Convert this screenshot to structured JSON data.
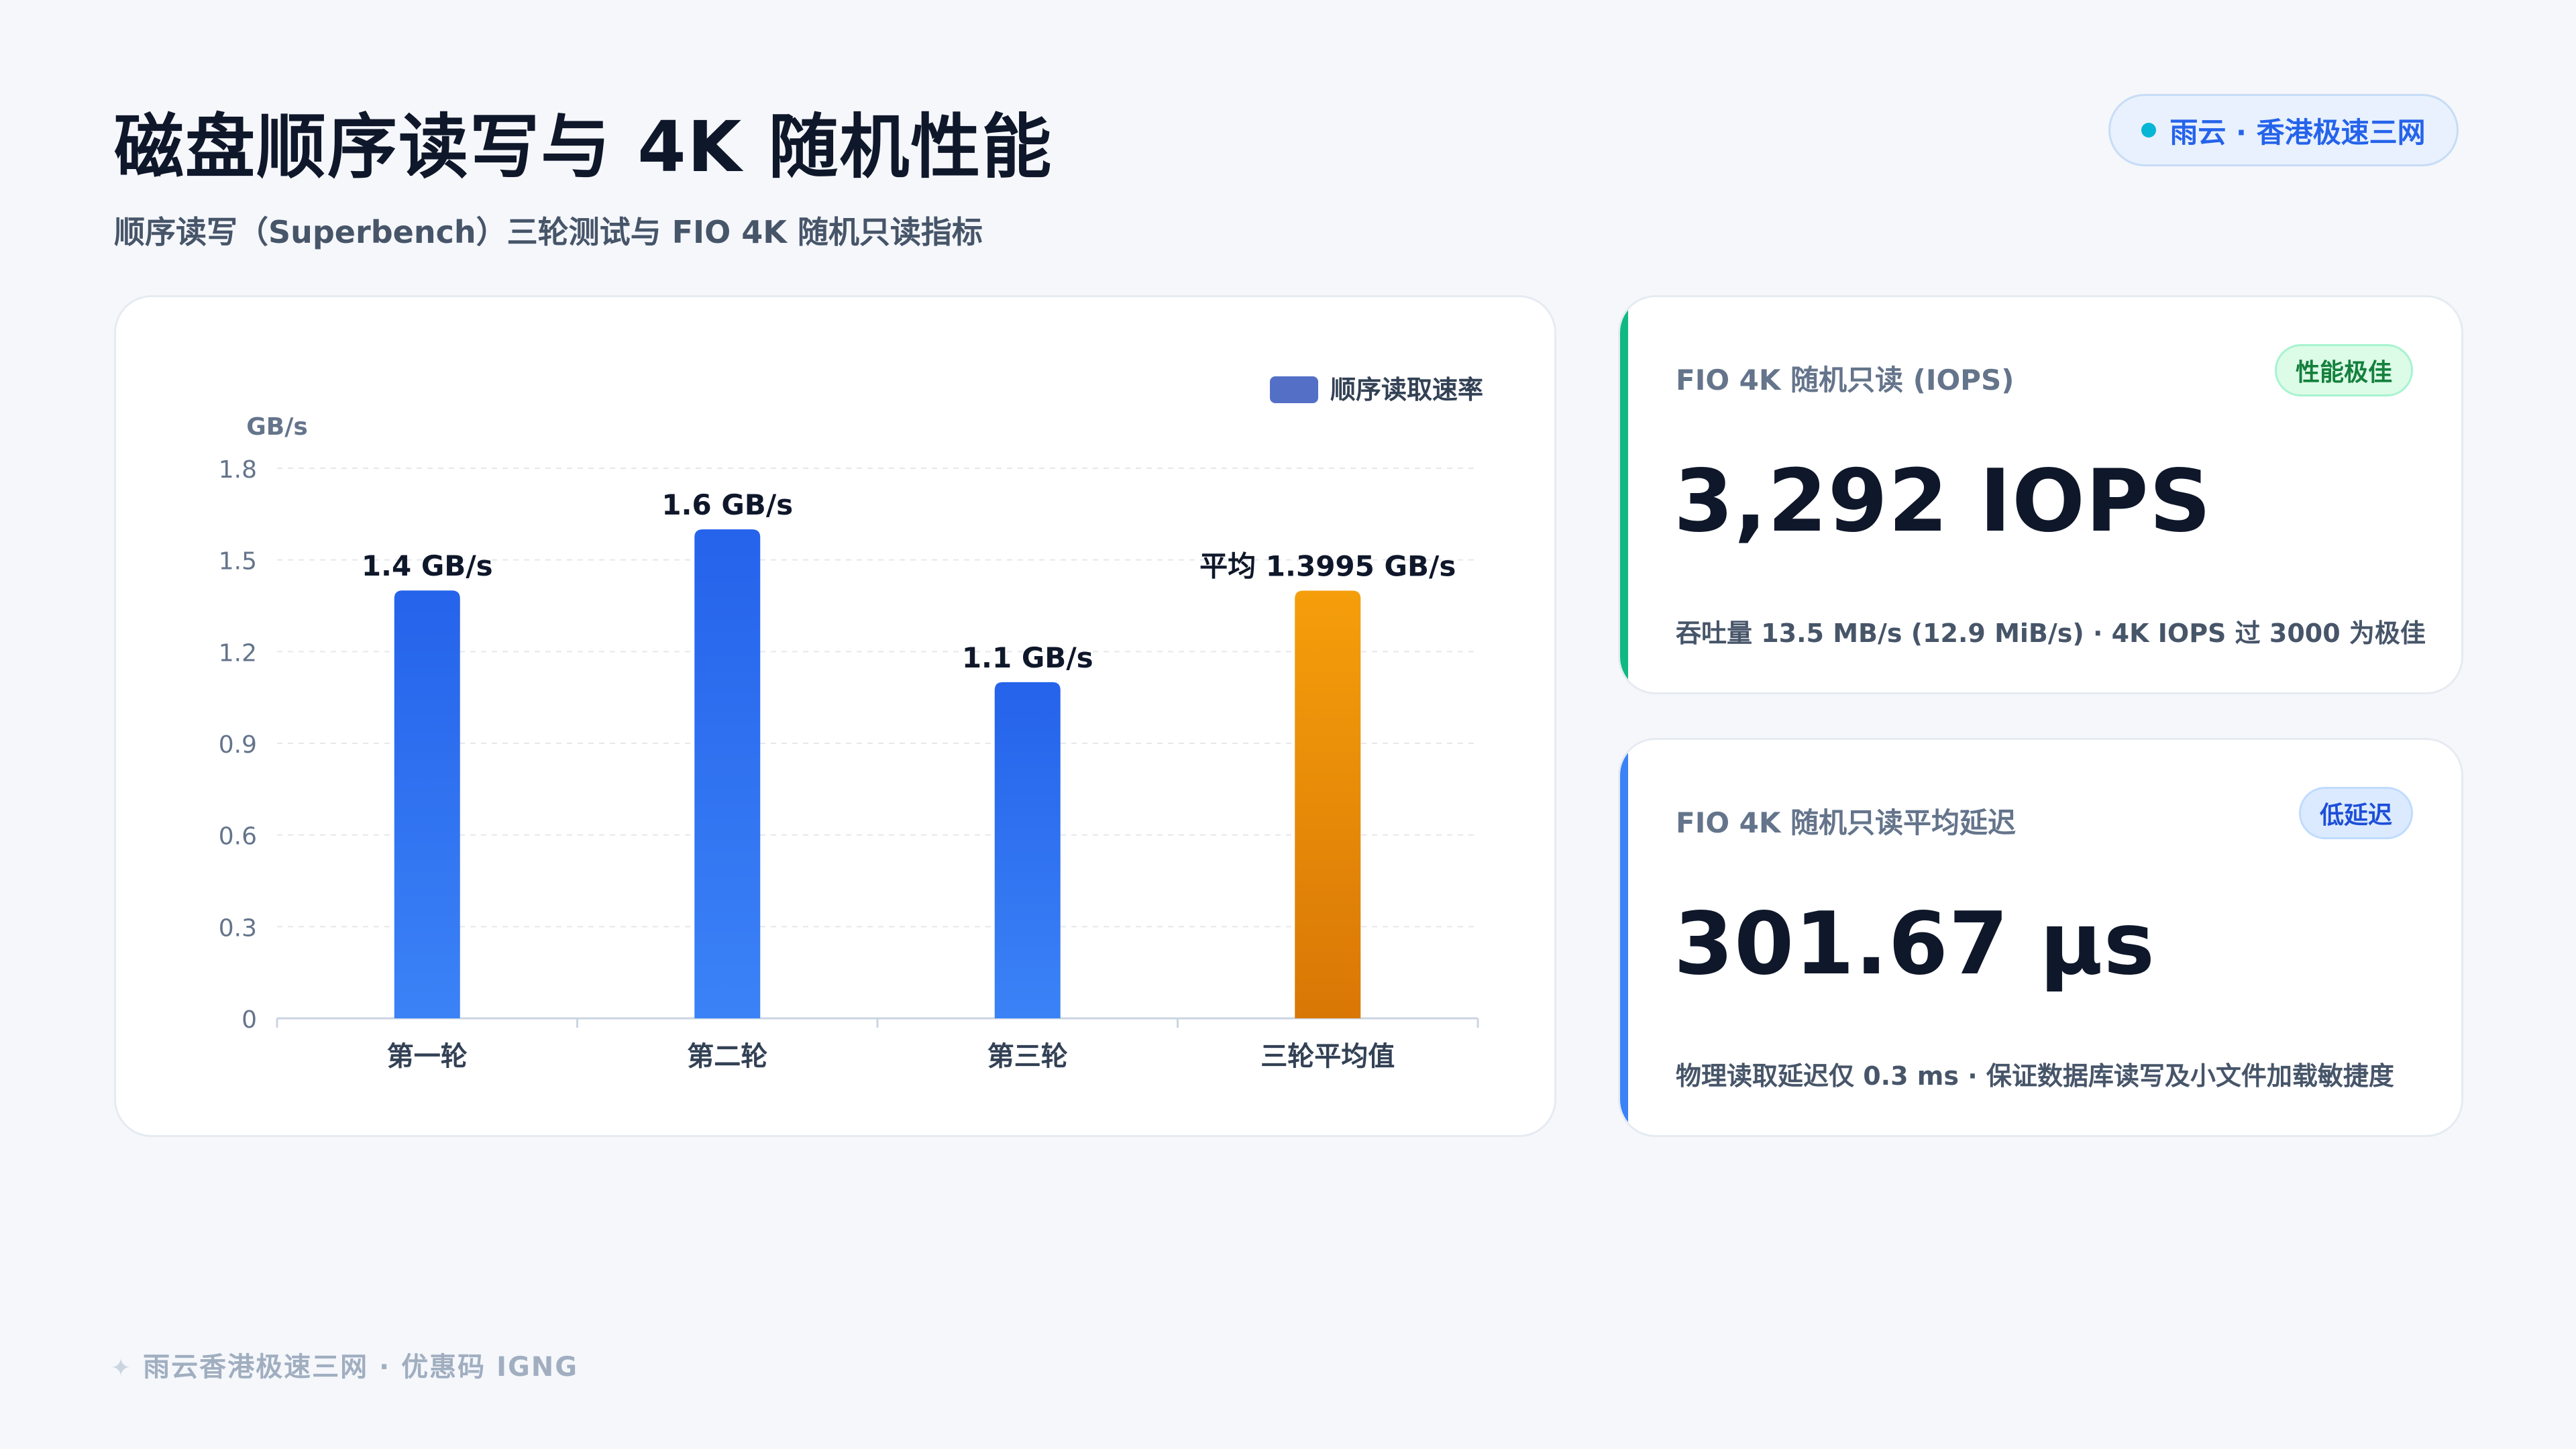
{
  "header": {
    "title": "磁盘顺序读写与 4K 随机性能",
    "subtitle": "顺序读写（Superbench）三轮测试与 FIO 4K 随机只读指标",
    "badge": "雨云 · 香港极速三网"
  },
  "chart_data": {
    "type": "bar",
    "categories": [
      "第一轮",
      "第二轮",
      "第三轮",
      "三轮平均值"
    ],
    "series": [
      {
        "name": "顺序读取速率",
        "values": [
          1.4,
          1.6,
          1.1,
          1.3995
        ]
      }
    ],
    "data_labels": [
      "1.4 GB/s",
      "1.6 GB/s",
      "1.1 GB/s",
      "平均 1.3995 GB/s"
    ],
    "ylabel": "GB/s",
    "yticks": [
      "0",
      "0.3",
      "0.6",
      "0.9",
      "1.2",
      "1.5",
      "1.8"
    ],
    "ylim": [
      0,
      1.8
    ],
    "legend_position": "top-right",
    "grid": true,
    "colors": {
      "bar_top": "#2563eb",
      "bar_bottom": "#3b82f6",
      "avg_top": "#f59e0b",
      "avg_bottom": "#d97706",
      "legend": "#5470c6"
    }
  },
  "metrics": [
    {
      "label": "FIO 4K 随机只读 (IOPS)",
      "tag": "性能极佳",
      "value": "3,292 IOPS",
      "note": "吞吐量 13.5 MB/s (12.9 MiB/s) · 4K IOPS 过 3000 为极佳",
      "accent": "#10b981",
      "tag_bg": "#dcfce7",
      "tag_border": "#a7f3d0",
      "tag_color": "#15803d"
    },
    {
      "label": "FIO 4K 随机只读平均延迟",
      "tag": "低延迟",
      "value": "301.67 µs",
      "note": "物理读取延迟仅 0.3 ms · 保证数据库读写及小文件加载敏捷度",
      "accent": "#3b82f6",
      "tag_bg": "#dbeafe",
      "tag_border": "#bfdbfe",
      "tag_color": "#1d4ed8"
    }
  ],
  "footer": {
    "icon": "sparkle-icon",
    "text": "雨云香港极速三网 · 优惠码 IGNG"
  }
}
